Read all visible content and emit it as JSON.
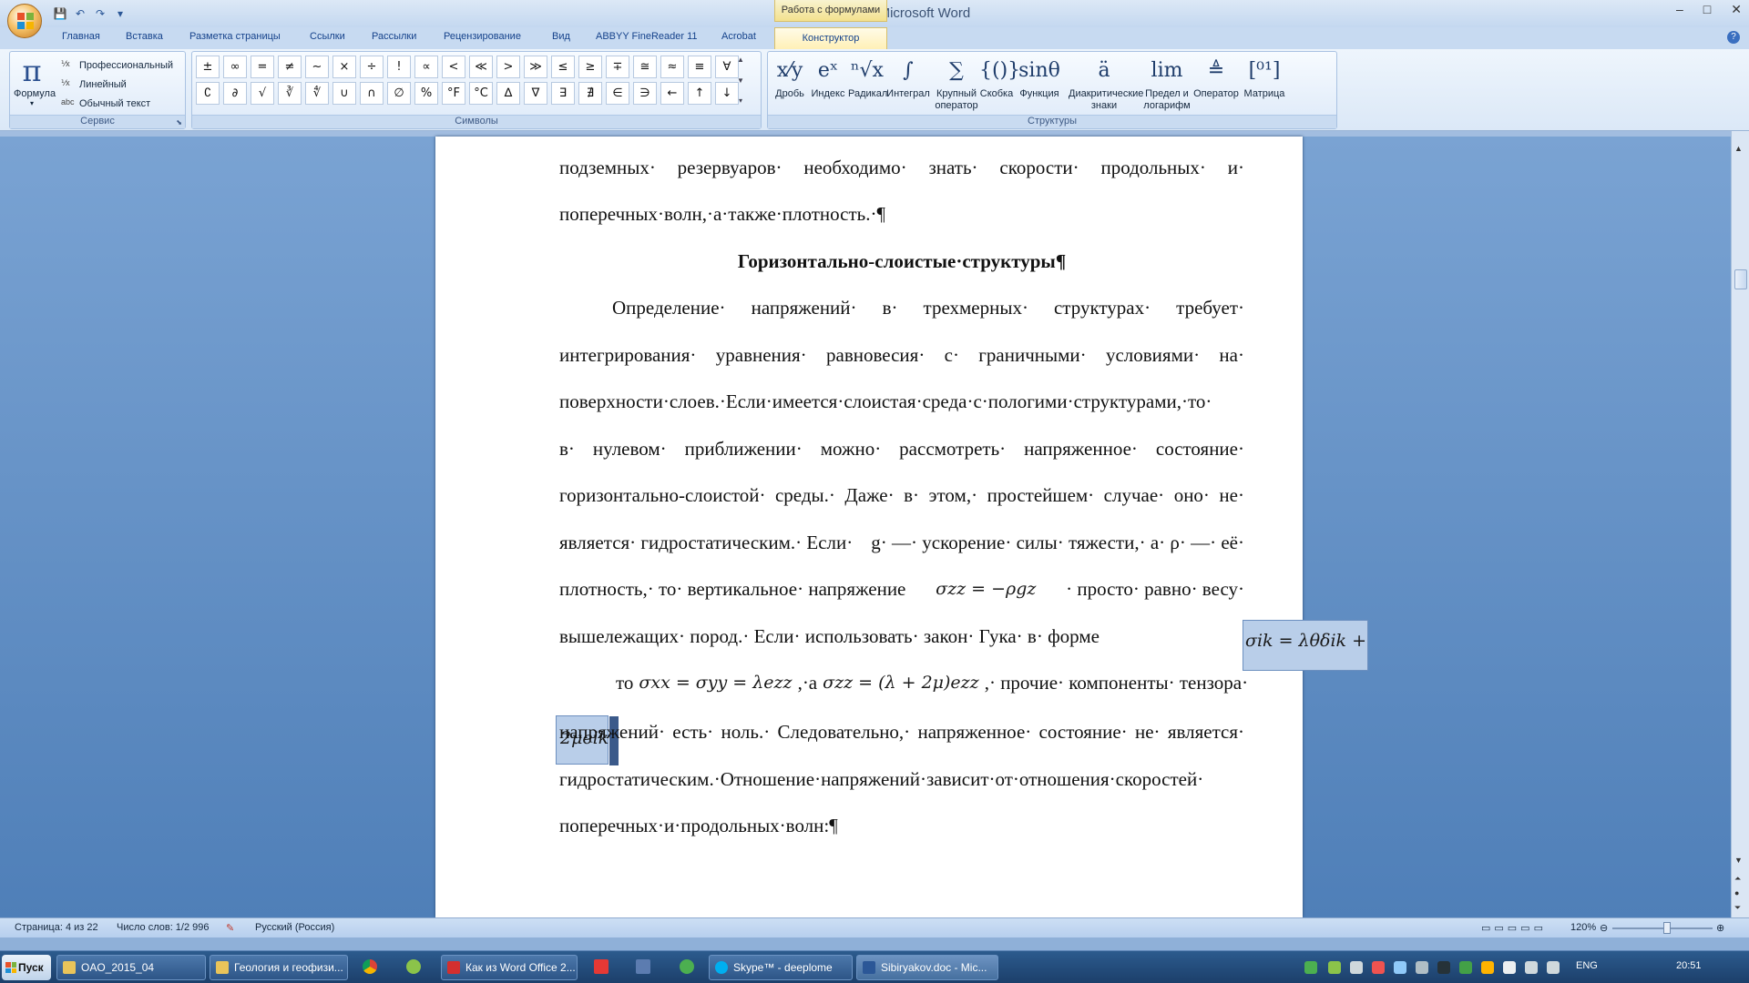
{
  "window": {
    "title": "Sibiryakov.doc - Microsoft Word",
    "context_group": "Работа с формулами",
    "controls": [
      "–",
      "□",
      "✕"
    ]
  },
  "qat": [
    "💾",
    "↶",
    "↷",
    "▾"
  ],
  "tabs": [
    {
      "label": "Главная"
    },
    {
      "label": "Вставка"
    },
    {
      "label": "Разметка страницы"
    },
    {
      "label": "Ссылки"
    },
    {
      "label": "Рассылки"
    },
    {
      "label": "Рецензирование"
    },
    {
      "label": "Вид"
    },
    {
      "label": "ABBYY FineReader 11"
    },
    {
      "label": "Acrobat"
    },
    {
      "label": "Конструктор"
    }
  ],
  "ribbon": {
    "service": {
      "label": "Сервис",
      "formula_label": "Формула",
      "formula_icon": "π",
      "modes": [
        "Профессиональный",
        "Линейный",
        "Обычный текст"
      ]
    },
    "symbols": {
      "label": "Символы",
      "items": [
        "±",
        "∞",
        "=",
        "≠",
        "~",
        "×",
        "÷",
        "!",
        "∝",
        "<",
        "≪",
        ">",
        "≫",
        "≤",
        "≥",
        "∓",
        "≅",
        "≈",
        "≡",
        "∀",
        "∁",
        "∂",
        "√",
        "∛",
        "∜",
        "∪",
        "∩",
        "∅",
        "%",
        "°F",
        "°C",
        "∆",
        "∇",
        "∃",
        "∄",
        "∈",
        "∋",
        "←",
        "↑",
        "↓"
      ]
    },
    "structures": {
      "label": "Структуры",
      "items": [
        {
          "icon": "x⁄y",
          "label": "Дробь"
        },
        {
          "icon": "eˣ",
          "label": "Индекс"
        },
        {
          "icon": "ⁿ√x",
          "label": "Радикал"
        },
        {
          "icon": "∫",
          "label": "Интеграл"
        },
        {
          "icon": "∑",
          "label": "Крупный оператор"
        },
        {
          "icon": "{()}",
          "label": "Скобка"
        },
        {
          "icon": "sinθ",
          "label": "Функция"
        },
        {
          "icon": "ä",
          "label": "Диакритические знаки"
        },
        {
          "icon": "lim",
          "label": "Предел и логарифм"
        },
        {
          "icon": "≜",
          "label": "Оператор"
        },
        {
          "icon": "[⁰¹]",
          "label": "Матрица"
        }
      ]
    }
  },
  "document": {
    "lines": [
      "подземных· резервуаров· необходимо· знать· скорости· продольных· и·",
      "поперечных·волн,·а·также·плотность.·¶",
      "Горизонтально-слоистые·структуры¶",
      "Определение· напряжений· в· трехмерных· структурах· требует·",
      "интегрирования· уравнения· равновесия· с· граничными· условиями· на·",
      "поверхности·слоев.·Если·имеется·слоистая·среда·с·пологими·структурами,·то·",
      "в· нулевом· приближении· можно· рассмотреть· напряженное· состояние·",
      "горизонтально-слоистой· среды.· Даже· в· этом,· простейшем· случае· оно· не·",
      "является· гидростатическим.· Если·",
      "плотность,· то· вертикальное· напряжение",
      "вышележащих· пород.· Если· использовать· закон· Гука· в· форме",
      "",
      "напряжений· есть· ноль.· Следовательно,· напряженное· состояние· не· является·",
      "гидростатическим.·Отношение·напряжений·зависит·от·отношения·скоростей·",
      "поперечных·и·продольных·волн:¶"
    ],
    "line8_tail": "g· —· ускорение· силы· тяжести,· а· ρ· —· её·",
    "line9_math": "σzz = −ρgz",
    "line9_tail": "· просто· равно· весу·",
    "line10_math": "σik = λθδik +",
    "line11_math_a": "2μeik",
    "line11_text": "то",
    "line11_math_b": "σxx = σyy = λezz",
    "line11_mid": ",·а",
    "line11_math_c": "σzz = (λ + 2μ)ezz",
    "line11_tail": ",· прочие· компоненты· тензора·"
  },
  "status": {
    "page": "Страница: 4 из 22",
    "words": "Число слов: 1/2 996",
    "lang": "Русский (Россия)",
    "zoom": "120%"
  },
  "taskbar": {
    "start": "Пуск",
    "tasks": [
      {
        "label": "OAO_2015_04"
      },
      {
        "label": "Геология и геофизи..."
      },
      {
        "label": "Как из Word Office 2..."
      },
      {
        "label": "Skype™ - deeplome"
      },
      {
        "label": "Sibiryakov.doc - Mic..."
      }
    ],
    "lang": "ENG",
    "clock": "20:51"
  },
  "colors": {
    "accent": "#2b5797",
    "selection": "#b9cee9",
    "context_tab": "#f3e18e"
  }
}
